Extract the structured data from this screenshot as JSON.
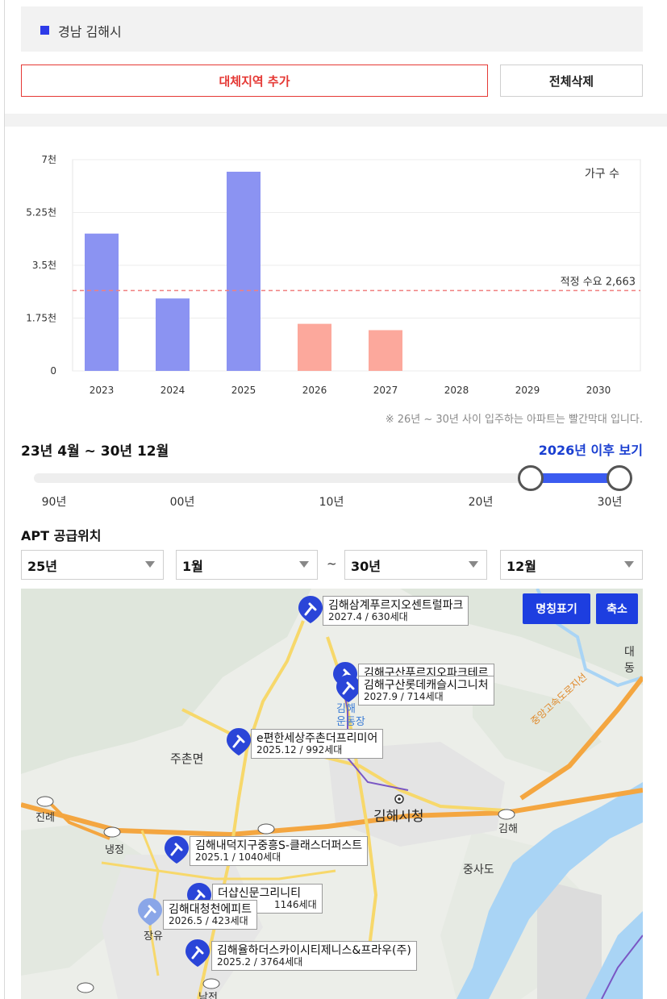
{
  "region": {
    "name": "경남 김해시",
    "marker_color": "#2d3be8"
  },
  "buttons": {
    "add_region": "대체지역 추가",
    "delete_all": "전체삭제"
  },
  "chart_data": {
    "type": "bar",
    "categories": [
      "2023",
      "2024",
      "2025",
      "2026",
      "2027",
      "2028",
      "2029",
      "2030"
    ],
    "values": [
      4550,
      2400,
      6600,
      1560,
      1350,
      0,
      0,
      0
    ],
    "bar_colors": [
      "#8b93f2",
      "#8b93f2",
      "#8b93f2",
      "#fca89c",
      "#fca89c",
      "#8b93f2",
      "#8b93f2",
      "#8b93f2"
    ],
    "ylim": [
      0,
      7000
    ],
    "yticks": [
      0,
      1750,
      3500,
      5250,
      7000
    ],
    "ytick_labels": [
      "0",
      "1.75천",
      "3.5천",
      "5.25천",
      "7천"
    ],
    "legend_label": "가구 수",
    "reference_line": {
      "value": 2663,
      "label": "적정 수요 2,663",
      "color": "#f08080"
    },
    "grid": true
  },
  "chart_note": "※ 26년 ~ 30년 사이 입주하는 아파트는 빨간막대 입니다.",
  "range": {
    "title": "23년 4월 ~ 30년 12월",
    "link": "2026년 이후 보기",
    "labels": [
      "90년",
      "00년",
      "10년",
      "20년",
      "30년"
    ],
    "selected_start_fraction": 0.86,
    "selected_end_fraction": 1.0
  },
  "apt_section": {
    "title": "APT 공급위치",
    "from_year": "25년",
    "from_month": "1월",
    "separator": "~",
    "to_year": "30년",
    "to_month": "12월"
  },
  "map": {
    "buttons": {
      "names": "명칭표기",
      "zoom_out": "축소"
    },
    "place_labels": {
      "juchon": "주촌면",
      "jinrye": "진례",
      "naejeong": "냉정",
      "cityhall": "김해시청",
      "gimhae": "김해",
      "jungsa": "중사도",
      "jangyu": "장유",
      "daedong": "대동",
      "stadium_a": "김해",
      "stadium_b": "운동장",
      "expressway": "중앙고속도로지선",
      "najeon": "남전"
    },
    "apartments": [
      {
        "name": "김해삼계푸르지오센트럴파크",
        "sub": "2027.4 / 630세대"
      },
      {
        "name": "김해구산푸르지오파크테르",
        "sub": ""
      },
      {
        "name": "김해구산롯데캐슬시그니처",
        "sub": "2027.9 / 714세대"
      },
      {
        "name": "e편한세상주촌더프리미어",
        "sub": "2025.12 / 992세대"
      },
      {
        "name": "김해내덕지구중흥S-클래스더퍼스트",
        "sub": "2025.1 / 1040세대"
      },
      {
        "name": "더샵신문그리니티",
        "sub": "1146세대"
      },
      {
        "name": "김해대청천에피트",
        "sub": "2026.5 / 423세대"
      },
      {
        "name": "김해율하더스카이시티제니스&프라우(주)",
        "sub": "2025.2 / 3764세대"
      }
    ]
  }
}
